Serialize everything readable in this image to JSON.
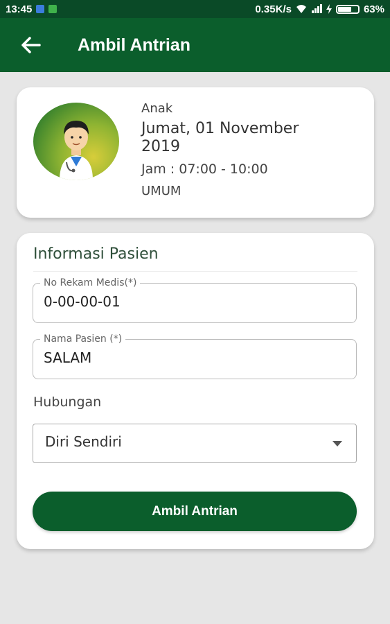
{
  "status_bar": {
    "time": "13:45",
    "network_speed": "0.35K/s",
    "battery_percent": "63%"
  },
  "app_bar": {
    "title": "Ambil Antrian",
    "back_icon": "arrow-left-icon"
  },
  "doctor_card": {
    "poli": "Anak",
    "date": "Jumat, 01 November 2019",
    "jam": "Jam : 07:00 - 10:00",
    "layanan": "UMUM",
    "avatar_icon": "doctor-avatar-icon"
  },
  "form": {
    "section_title": "Informasi Pasien",
    "rekam_medis": {
      "label": "No Rekam Medis(*)",
      "value": "0-00-00-01"
    },
    "nama_pasien": {
      "label": "Nama Pasien (*)",
      "value": "SALAM"
    },
    "hubungan": {
      "label": "Hubungan",
      "selected": "Diri Sendiri"
    },
    "submit_label": "Ambil Antrian"
  },
  "colors": {
    "primary": "#0b5e2c",
    "status_bar": "#0a4a27",
    "background": "#e6e6e6"
  }
}
